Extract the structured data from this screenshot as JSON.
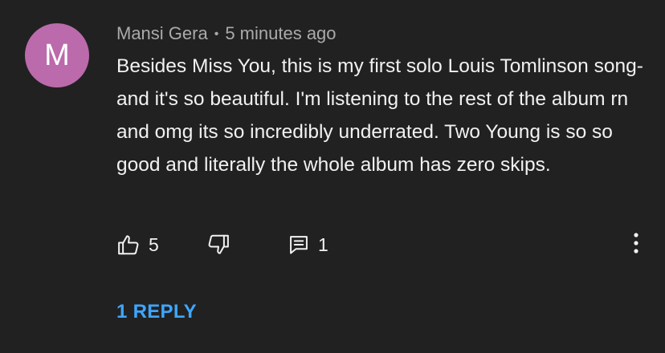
{
  "comment": {
    "avatar_letter": "M",
    "avatar_color": "#bb6aab",
    "author": "Mansi Gera",
    "separator": "•",
    "timestamp": "5 minutes ago",
    "text": "Besides Miss You, this is my first solo Louis Tomlinson song- and it's so beautiful. I'm listening to the rest of the album rn and omg its so incredibly underrated. Two Young is so so good and literally the whole album has zero skips."
  },
  "actions": {
    "like_icon": "thumbs-up-icon",
    "like_count": "5",
    "dislike_icon": "thumbs-down-icon",
    "reply_icon": "comment-icon",
    "reply_count": "1",
    "more_icon": "more-vertical-icon"
  },
  "replies": {
    "label": "1 REPLY",
    "color": "#3ea6ff"
  },
  "theme": {
    "background": "#212121",
    "text_primary": "#f1f1f1",
    "text_secondary": "#aaaaaa"
  }
}
